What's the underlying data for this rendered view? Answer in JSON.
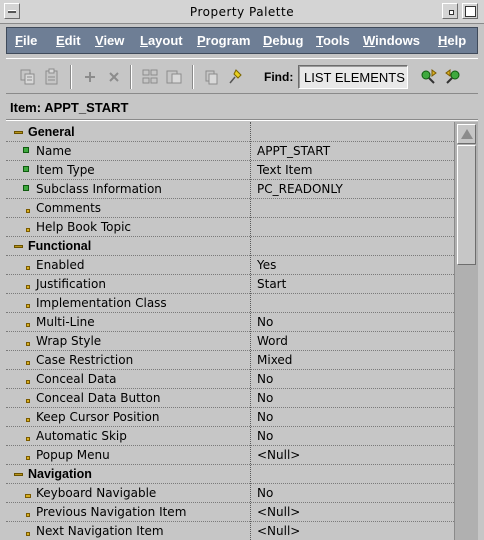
{
  "window": {
    "title": "Property Palette"
  },
  "menubar": {
    "items": [
      "File",
      "Edit",
      "View",
      "Layout",
      "Program",
      "Debug",
      "Tools",
      "Windows",
      "Help"
    ]
  },
  "toolbar": {
    "find_label": "Find:",
    "find_value": "LIST ELEMENTS",
    "icons": [
      "copy-properties-icon",
      "paste-properties-icon",
      "add-property-icon",
      "delete-property-icon",
      "union-icon",
      "intersection-icon",
      "inherit-icon",
      "freeze-icon",
      "find-next-icon",
      "find-previous-icon"
    ]
  },
  "item": {
    "label": "Item: APPT_START"
  },
  "properties": [
    {
      "type": "category",
      "label": "General"
    },
    {
      "type": "prop",
      "label": "Name",
      "value": "APPT_START",
      "marker": "green"
    },
    {
      "type": "prop",
      "label": "Item Type",
      "value": "Text Item",
      "marker": "green"
    },
    {
      "type": "prop",
      "label": "Subclass Information",
      "value": "PC_READONLY",
      "marker": "green"
    },
    {
      "type": "prop",
      "label": "Comments",
      "value": "",
      "marker": "yellow"
    },
    {
      "type": "prop",
      "label": "Help Book Topic",
      "value": "",
      "marker": "yellow"
    },
    {
      "type": "category",
      "label": "Functional"
    },
    {
      "type": "prop",
      "label": "Enabled",
      "value": "Yes",
      "marker": "yellow"
    },
    {
      "type": "prop",
      "label": "Justification",
      "value": "Start",
      "marker": "yellow"
    },
    {
      "type": "prop",
      "label": "Implementation Class",
      "value": "",
      "marker": "yellow"
    },
    {
      "type": "prop",
      "label": "Multi-Line",
      "value": "No",
      "marker": "yellow"
    },
    {
      "type": "prop",
      "label": "Wrap Style",
      "value": "Word",
      "marker": "yellow"
    },
    {
      "type": "prop",
      "label": "Case Restriction",
      "value": "Mixed",
      "marker": "yellow"
    },
    {
      "type": "prop",
      "label": "Conceal Data",
      "value": "No",
      "marker": "yellow"
    },
    {
      "type": "prop",
      "label": "Conceal Data Button",
      "value": "No",
      "marker": "yellow"
    },
    {
      "type": "prop",
      "label": "Keep Cursor Position",
      "value": "No",
      "marker": "yellow"
    },
    {
      "type": "prop",
      "label": "Automatic Skip",
      "value": "No",
      "marker": "yellow"
    },
    {
      "type": "prop",
      "label": "Popup Menu",
      "value": "<Null>",
      "marker": "yellow"
    },
    {
      "type": "category",
      "label": "Navigation"
    },
    {
      "type": "prop",
      "label": "Keyboard Navigable",
      "value": "No",
      "marker": "yellow-wide"
    },
    {
      "type": "prop",
      "label": "Previous Navigation Item",
      "value": "<Null>",
      "marker": "yellow"
    },
    {
      "type": "prop",
      "label": "Next Navigation Item",
      "value": "<Null>",
      "marker": "yellow"
    }
  ],
  "colors": {
    "menubar_bg": "#6e7e95",
    "panel_bg": "#c6c6c6",
    "category_icon": "#b8941c",
    "marker_green": "#3fa93f",
    "marker_yellow": "#d8b020"
  }
}
